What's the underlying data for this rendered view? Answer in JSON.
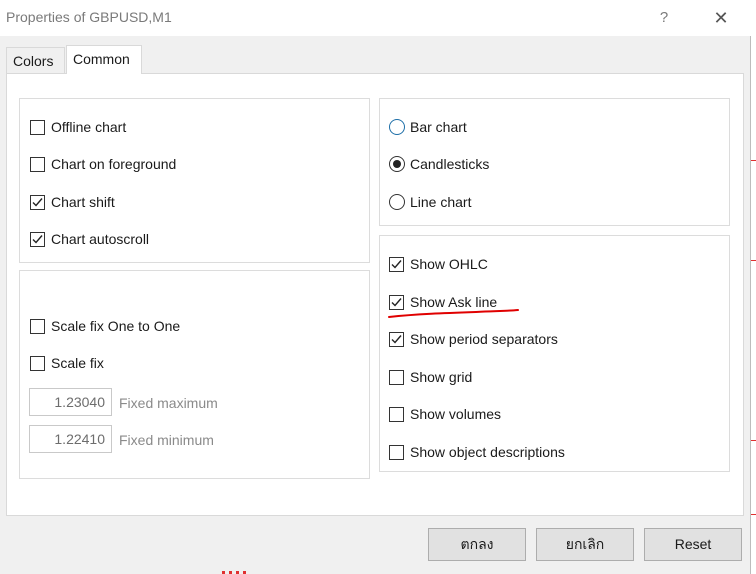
{
  "window": {
    "title": "Properties of GBPUSD,M1",
    "help_glyph": "?",
    "close_glyph": "✕"
  },
  "tabs": [
    {
      "label": "Colors",
      "active": false
    },
    {
      "label": "Common",
      "active": true
    }
  ],
  "options_left": [
    {
      "label": "Offline chart",
      "checked": false
    },
    {
      "label": "Chart on foreground",
      "checked": false
    },
    {
      "label": "Chart shift",
      "checked": true
    },
    {
      "label": "Chart autoscroll",
      "checked": true
    }
  ],
  "scale": {
    "one_to_one": {
      "label": "Scale fix One to One",
      "checked": false
    },
    "fix": {
      "label": "Scale fix",
      "checked": false
    },
    "fixed_maximum": {
      "value": "1.23040",
      "label": "Fixed maximum"
    },
    "fixed_minimum": {
      "value": "1.22410",
      "label": "Fixed minimum"
    }
  },
  "chart_type": [
    {
      "label": "Bar chart",
      "selected": false
    },
    {
      "label": "Candlesticks",
      "selected": true
    },
    {
      "label": "Line chart",
      "selected": false
    }
  ],
  "show_options": [
    {
      "label": "Show OHLC",
      "checked": true
    },
    {
      "label": "Show Ask line",
      "checked": true
    },
    {
      "label": "Show period separators",
      "checked": true
    },
    {
      "label": "Show grid",
      "checked": false
    },
    {
      "label": "Show volumes",
      "checked": false
    },
    {
      "label": "Show object descriptions",
      "checked": false
    }
  ],
  "buttons": {
    "ok": "ตกลง",
    "cancel": "ยกเลิก",
    "reset": "Reset"
  },
  "colors": {
    "annotation_red": "#e00000",
    "radio_blue": "#1e6fa8"
  }
}
